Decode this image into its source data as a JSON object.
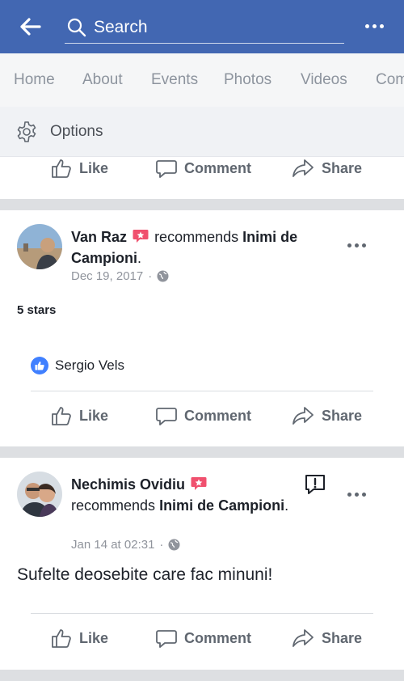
{
  "header": {
    "search_placeholder": "Search",
    "back_icon": "arrow-left-icon",
    "more_icon": "more-dots-icon",
    "background": "#4267b2"
  },
  "tabs": [
    "Home",
    "About",
    "Events",
    "Photos",
    "Videos",
    "Com"
  ],
  "options": {
    "label": "Options",
    "icon": "gear-icon"
  },
  "actions": {
    "like": "Like",
    "comment": "Comment",
    "share": "Share"
  },
  "posts": [
    {
      "author": "Van Raz",
      "verb": "recommends",
      "page": "Inimi de Campioni",
      "date": "Dec 19, 2017",
      "rating_text": "5 stars",
      "liked_by": "Sergio Vels"
    },
    {
      "author": "Nechimis Ovidiu",
      "verb": "recommends",
      "page": "Inimi de Campioni",
      "date": "Jan 14 at 02:31",
      "body": "Sufelte deosebite care fac minuni!"
    }
  ]
}
